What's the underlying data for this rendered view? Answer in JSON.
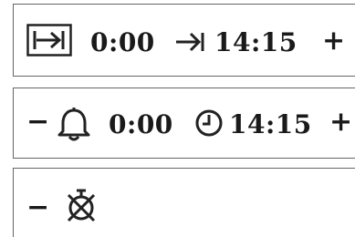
{
  "row1": {
    "start_icon": "tab-box-arrow-icon",
    "start_time": "0:00",
    "arrow_icon": "arrow-to-bar-icon",
    "end_time": "14:15",
    "plus_label": "+"
  },
  "row2": {
    "minus_label": "−",
    "bell_icon": "bell-icon",
    "bell_time": "0:00",
    "clock_icon": "clock-icon",
    "clock_time": "14:15",
    "plus_label": "+"
  },
  "row3": {
    "minus_label": "−",
    "alarm_off_icon": "alarm-off-icon"
  }
}
